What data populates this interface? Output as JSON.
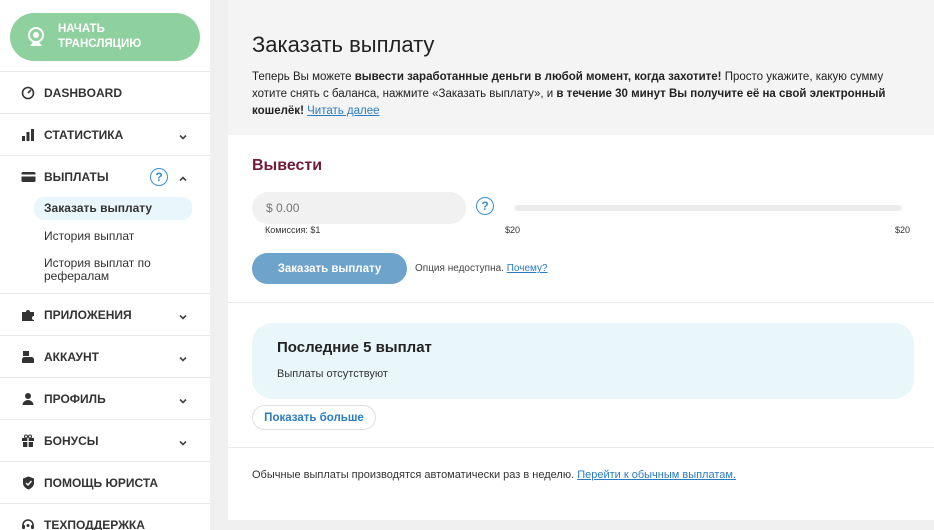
{
  "sidebar": {
    "stream_button": "НАЧАТЬ ТРАНСЛЯЦИЮ",
    "items": [
      {
        "label": "DASHBOARD",
        "icon": "gauge-icon"
      },
      {
        "label": "СТАТИСТИКА",
        "icon": "bar-chart-icon"
      },
      {
        "label": "ВЫПЛАТЫ",
        "icon": "credit-card-icon"
      },
      {
        "label": "ПРИЛОЖЕНИЯ",
        "icon": "puzzle-icon"
      },
      {
        "label": "АККАУНТ",
        "icon": "user-tie-icon"
      },
      {
        "label": "ПРОФИЛЬ",
        "icon": "user-icon"
      },
      {
        "label": "БОНУСЫ",
        "icon": "gift-icon"
      },
      {
        "label": "ПОМОЩЬ ЮРИСТА",
        "icon": "shield-icon"
      },
      {
        "label": "ТЕХПОДДЕРЖКА",
        "icon": "headset-icon"
      }
    ],
    "payouts_help": "?",
    "subitems": [
      "Заказать выплату",
      "История выплат",
      "История выплат по рефералам"
    ]
  },
  "main": {
    "title": "Заказать выплату",
    "intro": {
      "p1": "Теперь Вы можете ",
      "b1": "вывести заработанные деньги в любой момент, когда захотите!",
      "p2": " Просто укажите, какую сумму хотите снять с баланса, нажмите «Заказать выплату», и ",
      "b2": "в течение 30 минут Вы получите её на свой электронный кошелёк!",
      "link": "Читать далее"
    },
    "withdraw": {
      "title": "Вывести",
      "placeholder": "$ 0.00",
      "help": "?",
      "commission": "Комиссия: $1",
      "min": "$20",
      "max": "$20",
      "button": "Заказать выплату",
      "unavailable": "Опция недоступна.",
      "why": "Почему?"
    },
    "recent": {
      "title": "Последние 5 выплат",
      "empty": "Выплаты отсутствуют",
      "more": "Показать больше"
    },
    "footer": {
      "text": "Обычные выплаты производятся автоматически раз в неделю.",
      "link": "Перейти к обычным выплатам."
    }
  },
  "colors": {
    "stream_button": "#8fd19e",
    "accent": "#2a7bc0",
    "section_title": "#6e1c3a",
    "order_button": "#6ea3cc",
    "recent_bg": "#e9f7fb"
  }
}
